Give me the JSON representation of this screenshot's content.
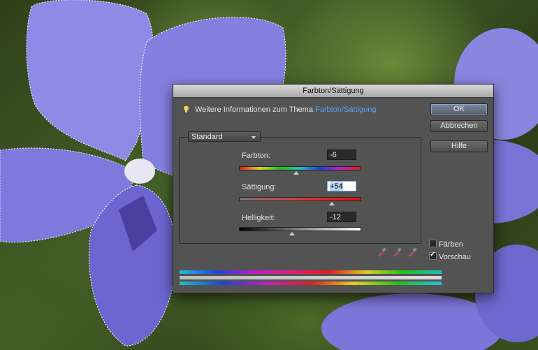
{
  "dialog": {
    "title": "Farbton/Sättigung",
    "info_text": "Weitere Informationen zum Thema ",
    "info_link": "Farbton/Sättigung",
    "buttons": {
      "ok": "OK",
      "cancel": "Abbrechen",
      "help": "Hilfe"
    },
    "preset": "Standard",
    "sliders": [
      {
        "label": "Farbton:",
        "value": "-6"
      },
      {
        "label": "Sättigung:",
        "value": "+54"
      },
      {
        "label": "Helligkeit:",
        "value": "-12"
      }
    ],
    "checkboxes": [
      {
        "label": "Färben",
        "checked": false
      },
      {
        "label": "Vorschau",
        "checked": true
      }
    ],
    "icons": [
      "eyedropper-icon",
      "eyedropper-plus-icon",
      "eyedropper-minus-icon",
      "lightbulb-icon"
    ],
    "colors": {
      "link": "#5aa6ea",
      "panel": "#535353"
    }
  }
}
